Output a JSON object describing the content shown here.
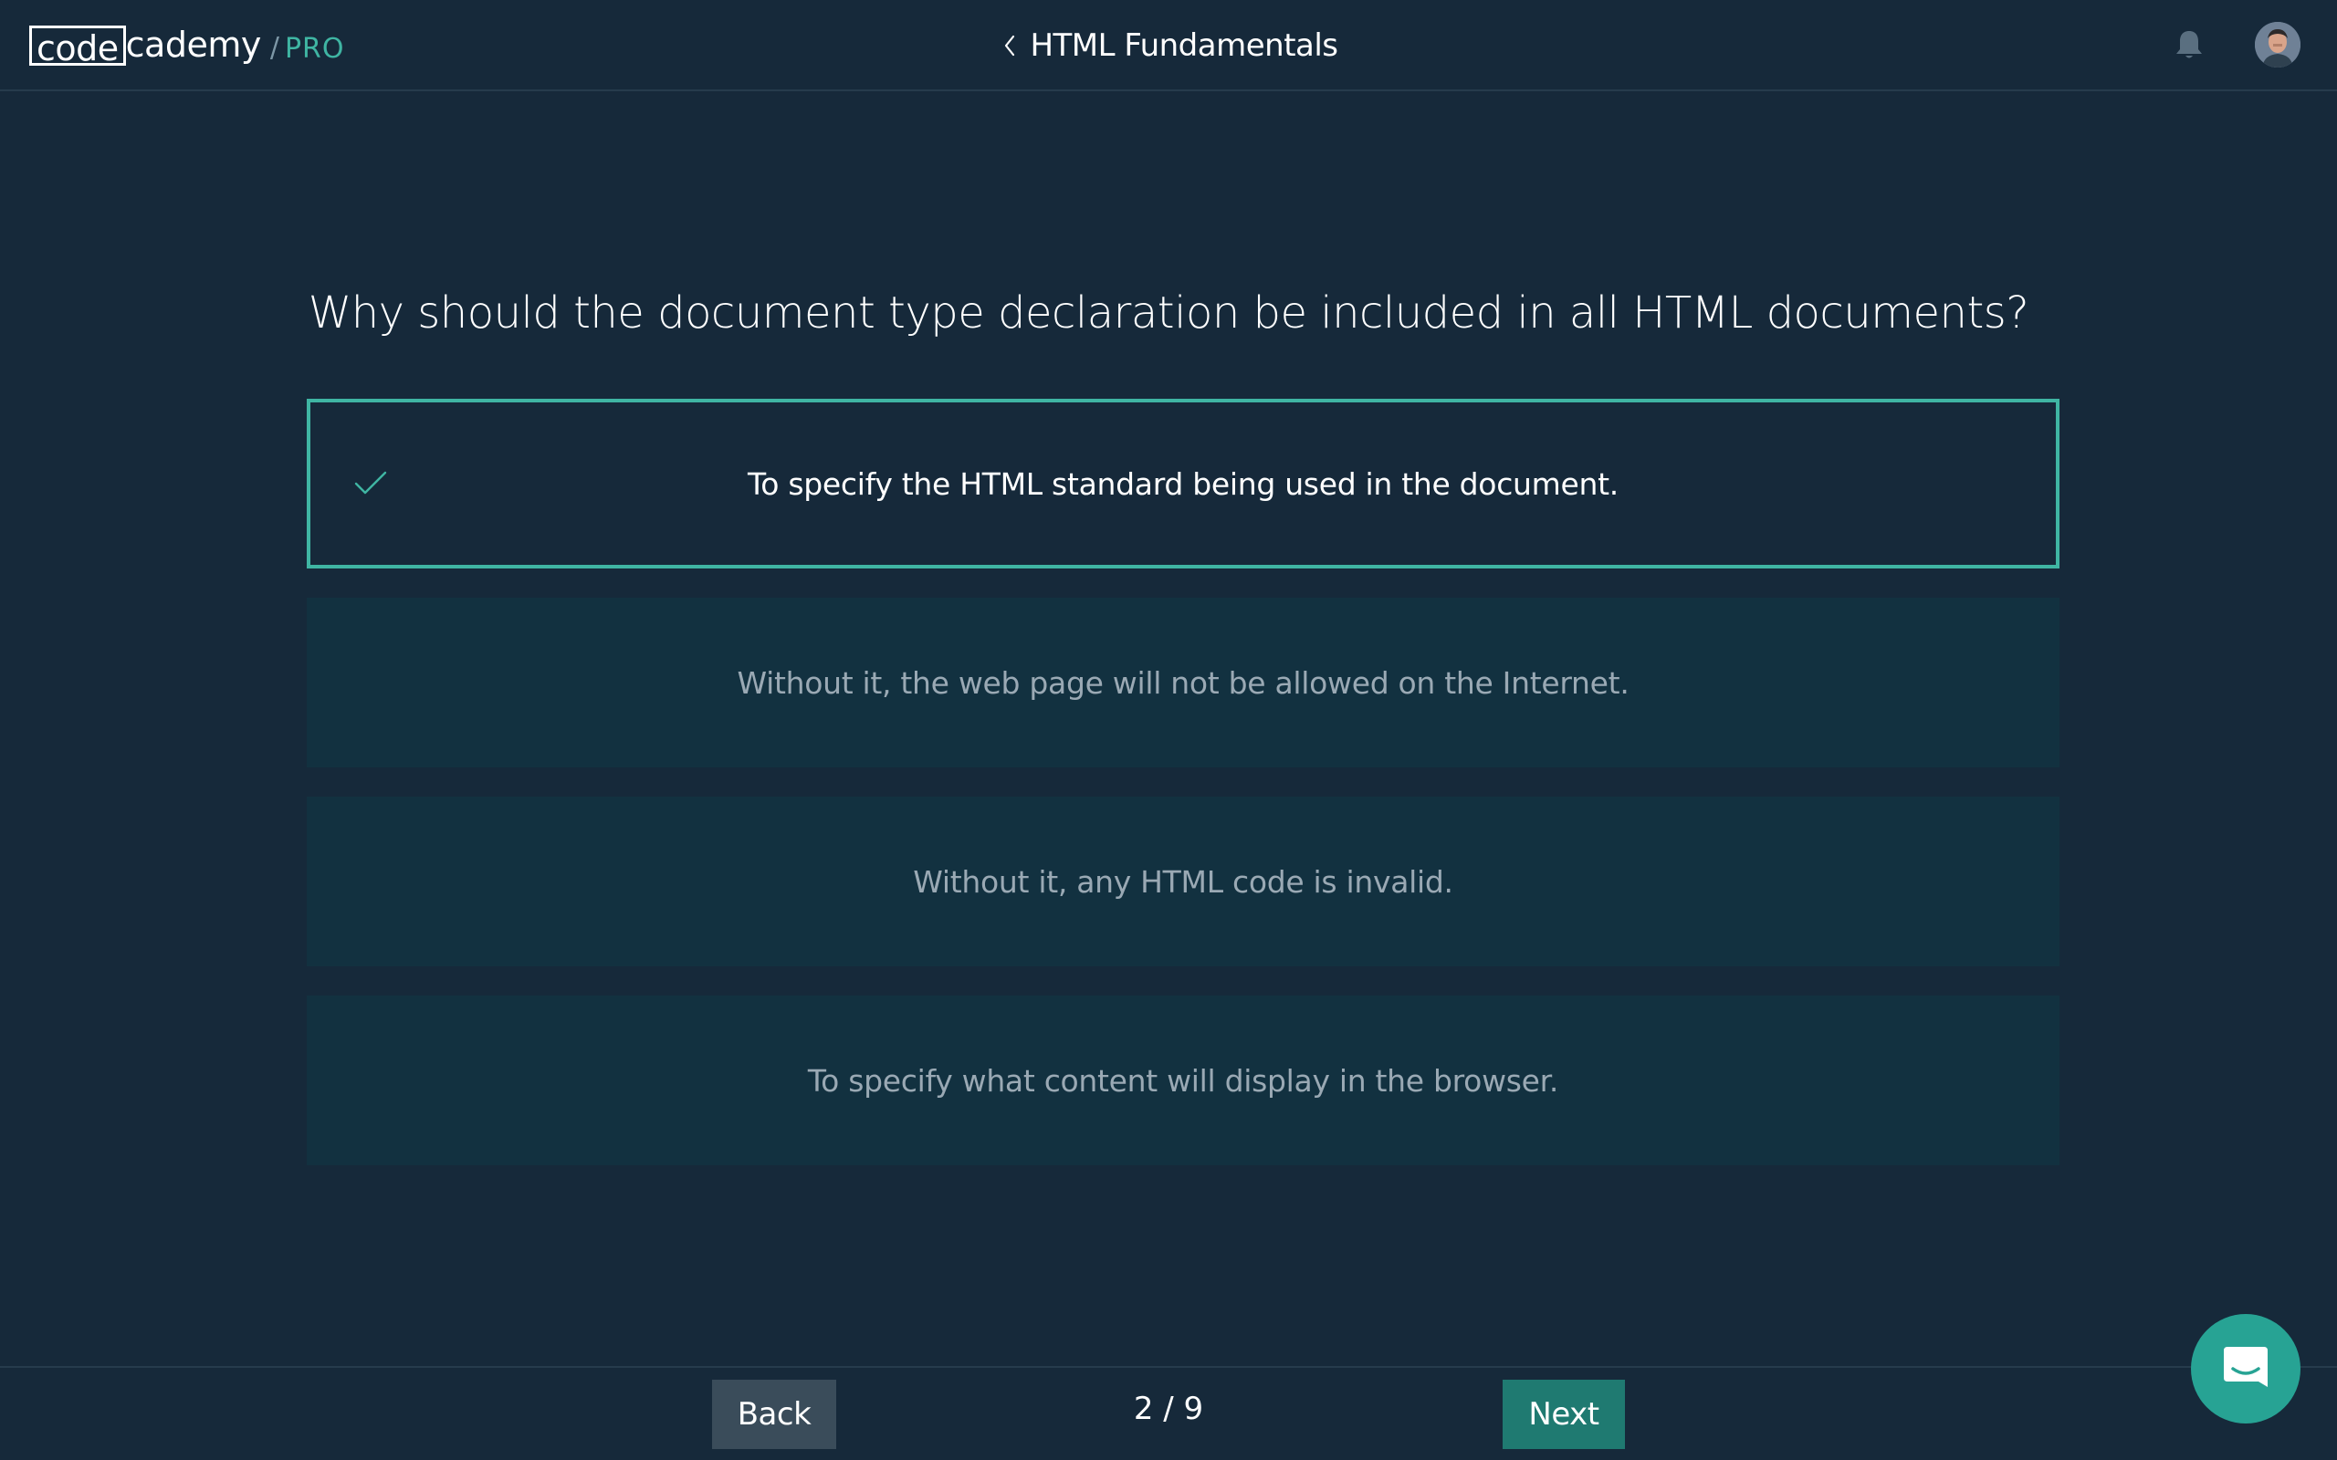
{
  "header": {
    "logo": {
      "boxed_text": "code",
      "rest_text": "cademy",
      "separator": "/",
      "tier": "PRO"
    },
    "course_title": "HTML Fundamentals",
    "icons": {
      "back": "chevron-left-icon",
      "notifications": "bell-icon",
      "profile": "avatar"
    }
  },
  "quiz": {
    "question": "Why should the document type declaration be included in all HTML documents?",
    "options": [
      {
        "label": "To specify the HTML standard being used in the document.",
        "selected": true
      },
      {
        "label": "Without it, the web page will not be allowed on the Internet.",
        "selected": false
      },
      {
        "label": "Without it, any HTML code is invalid.",
        "selected": false
      },
      {
        "label": "To specify what content will display in the browser.",
        "selected": false
      }
    ]
  },
  "footer": {
    "back_label": "Back",
    "progress": "2 / 9",
    "next_label": "Next"
  },
  "colors": {
    "background": "#16293a",
    "accent": "#3fb5a3",
    "option_bg": "#123140",
    "next_button": "#1f7a71",
    "back_button": "#3a4c5a"
  }
}
